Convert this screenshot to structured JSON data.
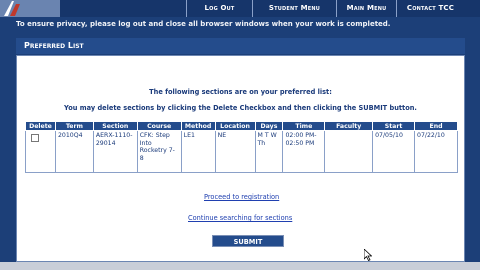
{
  "nav": {
    "logout": "Log Out",
    "student_menu": "Student Menu",
    "main_menu": "Main Menu",
    "contact": "Contact TCC"
  },
  "privacy_notice": "To ensure privacy, please log out and close all browser windows when your work is completed.",
  "page_title": "Preferred List",
  "intro": {
    "line1": "The following sections are on your preferred list:",
    "line2": "You may delete sections by clicking the Delete Checkbox and then clicking the SUBMIT button."
  },
  "table": {
    "headers": [
      "Delete",
      "Term",
      "Section",
      "Course",
      "Method",
      "Location",
      "Days",
      "Time",
      "Faculty",
      "Start",
      "End"
    ],
    "row": {
      "term": "2010Q4",
      "section": "AERX-1110-29014",
      "course": "CFK: Step Into Rocketry 7-8",
      "method": "LE1",
      "location": "NE",
      "days": "M T W Th",
      "time": "02:00 PM-02:50 PM",
      "faculty": "",
      "start": "07/05/10",
      "end": "07/22/10"
    }
  },
  "links": {
    "proceed": "Proceed to registration",
    "continue": "Continue searching for sections"
  },
  "submit_label": "SUBMIT",
  "colors": {
    "background": "#1c3f78",
    "header_bar": "#244c8c",
    "link": "#2040b0"
  }
}
